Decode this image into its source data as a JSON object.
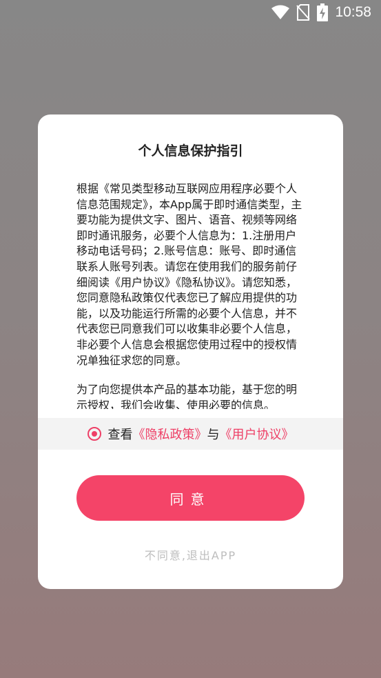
{
  "status_bar": {
    "time": "10:58",
    "icons": [
      "wifi-icon",
      "no-sim-icon",
      "battery-charging-icon"
    ]
  },
  "dialog": {
    "title": "个人信息保护指引",
    "paragraphs": [
      "根据《常见类型移动互联网应用程序必要个人信息范围规定》，本App属于即时通信类型，主要功能为提供文字、图片、语音、视频等网络即时通讯服务，必要个人信息为：1.注册用户移动电话号码；2.账号信息：账号、即时通信联系人账号列表。请您在使用我们的服务前仔细阅读《用户协议》《隐私协议》。请您知悉，您同意隐私政策仅代表您已了解应用提供的功能，以及功能运行所需的必要个人信息，并不代表您已同意我们可以收集非必要个人信息，非必要个人信息会根据您使用过程中的授权情况单独征求您的同意。",
      "为了向您提供本产品的基本功能，基于您的明示授权，我们会收集、使用必要的信息。"
    ],
    "consent": {
      "prefix": "查看",
      "privacy_link": "《隐私政策》",
      "connector": "与",
      "user_link": "《用户协议》"
    },
    "agree_label": "同意",
    "disagree_label": "不同意,退出APP"
  },
  "colors": {
    "accent": "#f44468",
    "link": "#ee3f66"
  }
}
